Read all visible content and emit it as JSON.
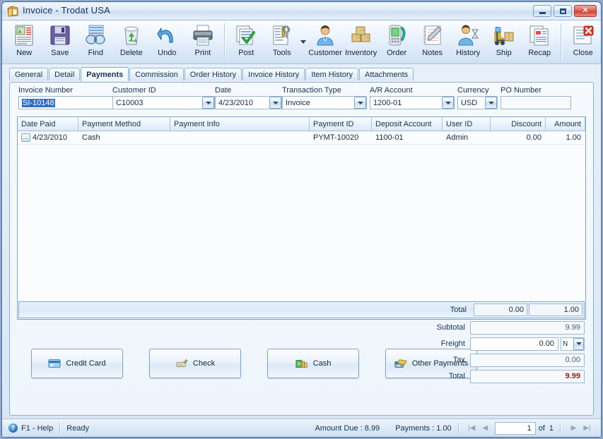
{
  "window": {
    "title": "Invoice - Trodat USA",
    "icon": "invoice-window-icon",
    "minimize_label": "Minimize",
    "maximize_label": "Maximize",
    "close_label": "Close"
  },
  "toolbar": {
    "items": [
      {
        "label": "New",
        "icon": "new-document-icon"
      },
      {
        "label": "Save",
        "icon": "floppy-disk-icon"
      },
      {
        "label": "Find",
        "icon": "binoculars-icon"
      },
      {
        "label": "Delete",
        "icon": "recycle-bin-icon"
      },
      {
        "label": "Undo",
        "icon": "undo-arrow-icon"
      },
      {
        "label": "Print",
        "icon": "printer-icon"
      },
      {
        "label": "Post",
        "icon": "post-checkmark-icon"
      },
      {
        "label": "Tools",
        "icon": "tools-wrench-icon"
      },
      {
        "label": "Customer",
        "icon": "customer-person-icon"
      },
      {
        "label": "Inventory",
        "icon": "inventory-boxes-icon"
      },
      {
        "label": "Order",
        "icon": "order-phone-icon"
      },
      {
        "label": "Notes",
        "icon": "notes-pencil-icon"
      },
      {
        "label": "History",
        "icon": "history-hourglass-icon"
      },
      {
        "label": "Ship",
        "icon": "forklift-ship-icon"
      },
      {
        "label": "Recap",
        "icon": "recap-report-icon"
      },
      {
        "label": "Close",
        "icon": "close-document-icon"
      }
    ]
  },
  "tabs": [
    {
      "label": "General",
      "active": false
    },
    {
      "label": "Detail",
      "active": false
    },
    {
      "label": "Payments",
      "active": true
    },
    {
      "label": "Commission",
      "active": false
    },
    {
      "label": "Order History",
      "active": false
    },
    {
      "label": "Invoice History",
      "active": false
    },
    {
      "label": "Item History",
      "active": false
    },
    {
      "label": "Attachments",
      "active": false
    }
  ],
  "header_fields": {
    "invoice_number": {
      "label": "Invoice Number",
      "value": "SI-10148",
      "selected": true
    },
    "customer_id": {
      "label": "Customer ID",
      "value": "C10003"
    },
    "date": {
      "label": "Date",
      "value": "4/23/2010"
    },
    "transaction_type": {
      "label": "Transaction Type",
      "value": "Invoice"
    },
    "ar_account": {
      "label": "A/R Account",
      "value": "1200-01"
    },
    "currency": {
      "label": "Currency",
      "value": "USD"
    },
    "po_number": {
      "label": "PO Number",
      "value": "",
      "placeholder": ""
    }
  },
  "grid": {
    "columns": [
      {
        "label": "Date Paid",
        "align": "left"
      },
      {
        "label": "Payment Method",
        "align": "left"
      },
      {
        "label": "Payment Info",
        "align": "left"
      },
      {
        "label": "Payment ID",
        "align": "left"
      },
      {
        "label": "Deposit Account",
        "align": "left"
      },
      {
        "label": "User ID",
        "align": "left"
      },
      {
        "label": "Discount",
        "align": "right"
      },
      {
        "label": "Amount",
        "align": "right"
      }
    ],
    "rows": [
      {
        "row_button": "...",
        "date_paid": "4/23/2010",
        "payment_method": "Cash",
        "payment_info": "",
        "payment_id": "PYMT-10020",
        "deposit_account": "1100-01",
        "user_id": "Admin",
        "discount": "0.00",
        "amount": "1.00"
      }
    ],
    "total_label": "Total",
    "total_discount": "0.00",
    "total_amount": "1.00"
  },
  "payment_buttons": [
    {
      "label": "Credit Card",
      "icon": "credit-card-icon"
    },
    {
      "label": "Check",
      "icon": "check-icon"
    },
    {
      "label": "Cash",
      "icon": "cash-icon"
    },
    {
      "label": "Other Payments",
      "icon": "other-payments-icon"
    }
  ],
  "totals": {
    "subtotal": {
      "label": "Subtotal",
      "value": "9.99"
    },
    "freight": {
      "label": "Freight",
      "value": "0.00",
      "method": "N"
    },
    "tax": {
      "label": "Tax",
      "value": "0.00"
    },
    "total": {
      "label": "Total",
      "value": "9.99"
    }
  },
  "statusbar": {
    "help": "F1 - Help",
    "status": "Ready",
    "amount_due": "Amount Due : 8.99",
    "payments": "Payments : 1.00",
    "page_current": "1",
    "page_of_label": "of",
    "page_total": "1",
    "nav_first": "|◀",
    "nav_prev": "◀",
    "nav_next": "▶",
    "nav_last": "▶|"
  },
  "colors": {
    "accent": "#2f6fc4",
    "grand_total": "#8c1d14",
    "title_text": "#15325c",
    "window_border": "#4a6a96"
  }
}
